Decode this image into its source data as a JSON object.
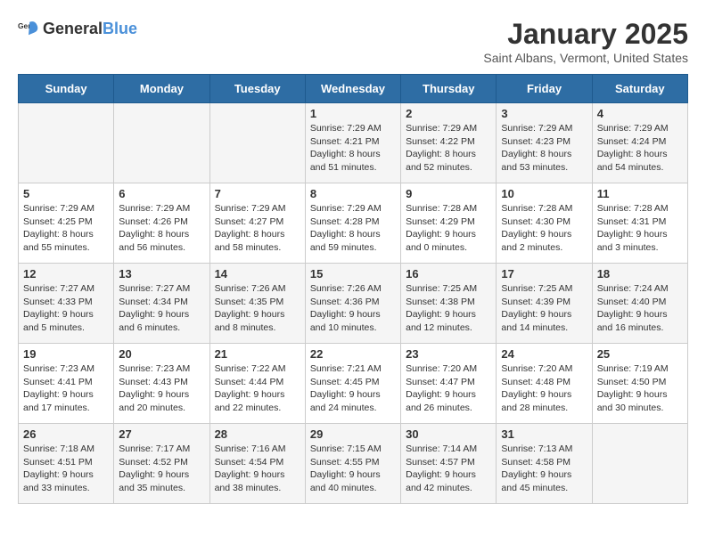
{
  "header": {
    "logo_general": "General",
    "logo_blue": "Blue",
    "title": "January 2025",
    "subtitle": "Saint Albans, Vermont, United States"
  },
  "weekdays": [
    "Sunday",
    "Monday",
    "Tuesday",
    "Wednesday",
    "Thursday",
    "Friday",
    "Saturday"
  ],
  "weeks": [
    [
      {
        "day": "",
        "info": ""
      },
      {
        "day": "",
        "info": ""
      },
      {
        "day": "",
        "info": ""
      },
      {
        "day": "1",
        "info": "Sunrise: 7:29 AM\nSunset: 4:21 PM\nDaylight: 8 hours and 51 minutes."
      },
      {
        "day": "2",
        "info": "Sunrise: 7:29 AM\nSunset: 4:22 PM\nDaylight: 8 hours and 52 minutes."
      },
      {
        "day": "3",
        "info": "Sunrise: 7:29 AM\nSunset: 4:23 PM\nDaylight: 8 hours and 53 minutes."
      },
      {
        "day": "4",
        "info": "Sunrise: 7:29 AM\nSunset: 4:24 PM\nDaylight: 8 hours and 54 minutes."
      }
    ],
    [
      {
        "day": "5",
        "info": "Sunrise: 7:29 AM\nSunset: 4:25 PM\nDaylight: 8 hours and 55 minutes."
      },
      {
        "day": "6",
        "info": "Sunrise: 7:29 AM\nSunset: 4:26 PM\nDaylight: 8 hours and 56 minutes."
      },
      {
        "day": "7",
        "info": "Sunrise: 7:29 AM\nSunset: 4:27 PM\nDaylight: 8 hours and 58 minutes."
      },
      {
        "day": "8",
        "info": "Sunrise: 7:29 AM\nSunset: 4:28 PM\nDaylight: 8 hours and 59 minutes."
      },
      {
        "day": "9",
        "info": "Sunrise: 7:28 AM\nSunset: 4:29 PM\nDaylight: 9 hours and 0 minutes."
      },
      {
        "day": "10",
        "info": "Sunrise: 7:28 AM\nSunset: 4:30 PM\nDaylight: 9 hours and 2 minutes."
      },
      {
        "day": "11",
        "info": "Sunrise: 7:28 AM\nSunset: 4:31 PM\nDaylight: 9 hours and 3 minutes."
      }
    ],
    [
      {
        "day": "12",
        "info": "Sunrise: 7:27 AM\nSunset: 4:33 PM\nDaylight: 9 hours and 5 minutes."
      },
      {
        "day": "13",
        "info": "Sunrise: 7:27 AM\nSunset: 4:34 PM\nDaylight: 9 hours and 6 minutes."
      },
      {
        "day": "14",
        "info": "Sunrise: 7:26 AM\nSunset: 4:35 PM\nDaylight: 9 hours and 8 minutes."
      },
      {
        "day": "15",
        "info": "Sunrise: 7:26 AM\nSunset: 4:36 PM\nDaylight: 9 hours and 10 minutes."
      },
      {
        "day": "16",
        "info": "Sunrise: 7:25 AM\nSunset: 4:38 PM\nDaylight: 9 hours and 12 minutes."
      },
      {
        "day": "17",
        "info": "Sunrise: 7:25 AM\nSunset: 4:39 PM\nDaylight: 9 hours and 14 minutes."
      },
      {
        "day": "18",
        "info": "Sunrise: 7:24 AM\nSunset: 4:40 PM\nDaylight: 9 hours and 16 minutes."
      }
    ],
    [
      {
        "day": "19",
        "info": "Sunrise: 7:23 AM\nSunset: 4:41 PM\nDaylight: 9 hours and 17 minutes."
      },
      {
        "day": "20",
        "info": "Sunrise: 7:23 AM\nSunset: 4:43 PM\nDaylight: 9 hours and 20 minutes."
      },
      {
        "day": "21",
        "info": "Sunrise: 7:22 AM\nSunset: 4:44 PM\nDaylight: 9 hours and 22 minutes."
      },
      {
        "day": "22",
        "info": "Sunrise: 7:21 AM\nSunset: 4:45 PM\nDaylight: 9 hours and 24 minutes."
      },
      {
        "day": "23",
        "info": "Sunrise: 7:20 AM\nSunset: 4:47 PM\nDaylight: 9 hours and 26 minutes."
      },
      {
        "day": "24",
        "info": "Sunrise: 7:20 AM\nSunset: 4:48 PM\nDaylight: 9 hours and 28 minutes."
      },
      {
        "day": "25",
        "info": "Sunrise: 7:19 AM\nSunset: 4:50 PM\nDaylight: 9 hours and 30 minutes."
      }
    ],
    [
      {
        "day": "26",
        "info": "Sunrise: 7:18 AM\nSunset: 4:51 PM\nDaylight: 9 hours and 33 minutes."
      },
      {
        "day": "27",
        "info": "Sunrise: 7:17 AM\nSunset: 4:52 PM\nDaylight: 9 hours and 35 minutes."
      },
      {
        "day": "28",
        "info": "Sunrise: 7:16 AM\nSunset: 4:54 PM\nDaylight: 9 hours and 38 minutes."
      },
      {
        "day": "29",
        "info": "Sunrise: 7:15 AM\nSunset: 4:55 PM\nDaylight: 9 hours and 40 minutes."
      },
      {
        "day": "30",
        "info": "Sunrise: 7:14 AM\nSunset: 4:57 PM\nDaylight: 9 hours and 42 minutes."
      },
      {
        "day": "31",
        "info": "Sunrise: 7:13 AM\nSunset: 4:58 PM\nDaylight: 9 hours and 45 minutes."
      },
      {
        "day": "",
        "info": ""
      }
    ]
  ]
}
